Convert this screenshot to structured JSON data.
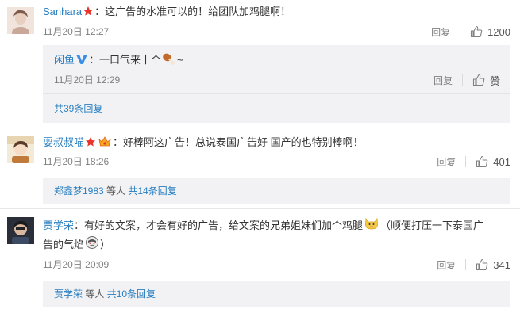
{
  "comments": [
    {
      "user": "Sanhara",
      "text": "：这广告的水准可以的！给团队加鸡腿啊！",
      "time": "11月20日 12:27",
      "reply_label": "回复",
      "likes": "1200",
      "sub_reply": {
        "user": "闲鱼",
        "text": "：一口气来十个",
        "tail": "~",
        "time": "11月20日 12:29",
        "reply_label": "回复",
        "like_label": "赞"
      },
      "more_text": "共39条回复"
    },
    {
      "user": "耍叔叔喵",
      "text": "：好棒阿这广告！总说泰国广告好 国产的也特别棒啊！",
      "time": "11月20日 18:26",
      "reply_label": "回复",
      "likes": "401",
      "more_user": "郑鑫梦1983",
      "more_mid": " 等人 ",
      "more_text": "共14条回复"
    },
    {
      "user": "贾学荣",
      "text_line1": "：有好的文案，才会有好的广告，给文案的兄弟姐妹们加个鸡腿",
      "text_line1b": "（顺便打压一下泰国广",
      "text_line2": "告的气焰",
      "text_line2b": "）",
      "time": "11月20日 20:09",
      "reply_label": "回复",
      "likes": "341",
      "more_user": "贾学荣",
      "more_mid": " 等人 ",
      "more_text": "共10条回复"
    }
  ],
  "colors": {
    "link": "#2a7fc0",
    "meta": "#808080",
    "reply_bg": "#f2f2f5",
    "star": "#e8352c"
  },
  "icons": {
    "like": "thumbs-up-icon",
    "verified": "verified-v-icon",
    "star": "star-badge-icon",
    "crown": "crown-badge-icon",
    "drumstick": "drumstick-emoji-icon",
    "cat": "cat-emoji-icon",
    "mask": "face-emoji-icon"
  }
}
